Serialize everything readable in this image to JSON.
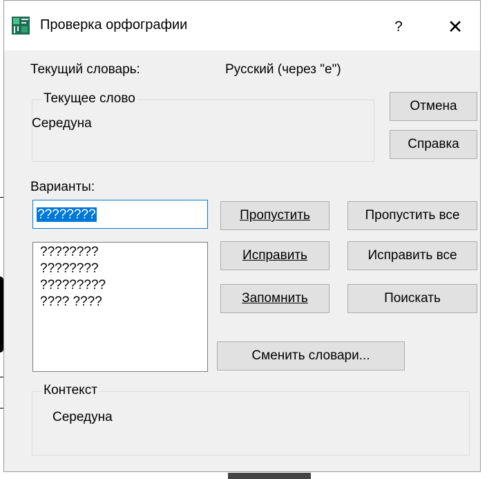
{
  "dialog": {
    "title": "Проверка орфографии",
    "help_label": "?",
    "close_label": "✕"
  },
  "current_dictionary": {
    "label": "Текущий словарь:",
    "value": "Русский (через \"е\")"
  },
  "current_word": {
    "caption": "Текущее слово",
    "value": "Середуна"
  },
  "buttons": {
    "cancel": "Отмена",
    "help": "Справка",
    "skip": "Пропустить",
    "skip_all": "Пропустить все",
    "fix": "Исправить",
    "fix_all": "Исправить все",
    "remember": "Запомнить",
    "search": "Поискать",
    "change_dictionaries": "Сменить словари..."
  },
  "variants": {
    "label": "Варианты:",
    "input_value": "????????",
    "items": [
      "????????",
      "????????",
      "?????????",
      "???? ????"
    ]
  },
  "context": {
    "caption": "Контекст",
    "value": "Середуна"
  }
}
